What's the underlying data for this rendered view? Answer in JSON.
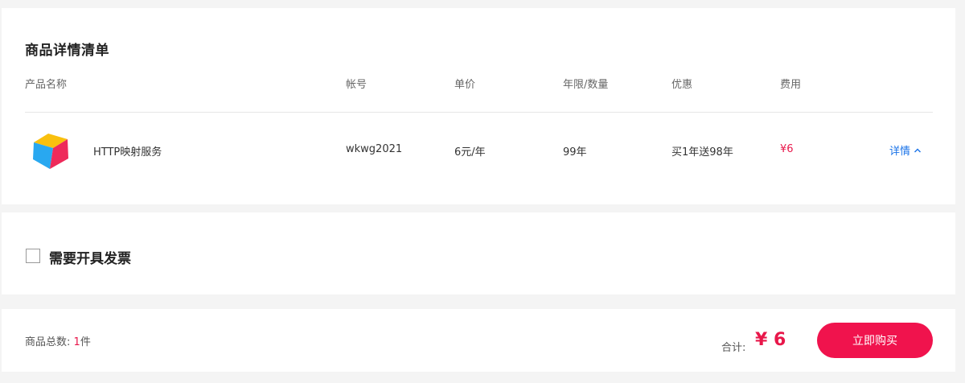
{
  "detail": {
    "title": "商品详情清单",
    "columns": {
      "name": "产品名称",
      "account": "帐号",
      "unit_price": "单价",
      "term": "年限/数量",
      "discount": "优惠",
      "cost": "费用"
    },
    "items": [
      {
        "logo_icon": "cube-logo-icon",
        "name": "HTTP映射服务",
        "account": "wkwg2021",
        "unit_price": "6元/年",
        "term": "99年",
        "discount": "买1年送98年",
        "cost": "¥6",
        "detail_label": "详情"
      }
    ]
  },
  "invoice": {
    "label": "需要开具发票",
    "checked": false
  },
  "footer": {
    "count_label": "商品总数:",
    "count_value": "1",
    "count_unit": "件",
    "sum_label": "合计:",
    "sum_value": "¥ 6",
    "buy_label": "立即购买"
  },
  "colors": {
    "accent_red": "#f0134d",
    "price_red": "#e8174a",
    "link_blue": "#1a73e8",
    "logo_yellow": "#f9c00e",
    "logo_blue": "#29a8f0",
    "logo_red": "#ee2a5a"
  }
}
